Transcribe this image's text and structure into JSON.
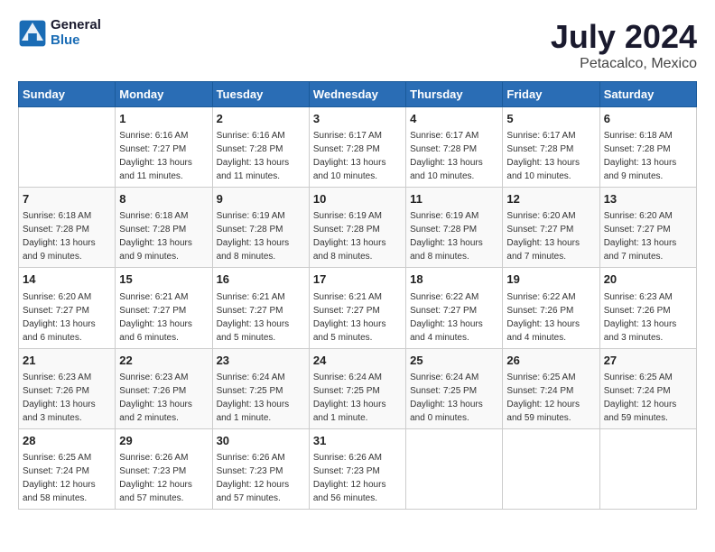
{
  "header": {
    "logo_line1": "General",
    "logo_line2": "Blue",
    "month_year": "July 2024",
    "location": "Petacalco, Mexico"
  },
  "columns": [
    "Sunday",
    "Monday",
    "Tuesday",
    "Wednesday",
    "Thursday",
    "Friday",
    "Saturday"
  ],
  "weeks": [
    [
      {
        "day": "",
        "info": ""
      },
      {
        "day": "1",
        "info": "Sunrise: 6:16 AM\nSunset: 7:27 PM\nDaylight: 13 hours\nand 11 minutes."
      },
      {
        "day": "2",
        "info": "Sunrise: 6:16 AM\nSunset: 7:28 PM\nDaylight: 13 hours\nand 11 minutes."
      },
      {
        "day": "3",
        "info": "Sunrise: 6:17 AM\nSunset: 7:28 PM\nDaylight: 13 hours\nand 10 minutes."
      },
      {
        "day": "4",
        "info": "Sunrise: 6:17 AM\nSunset: 7:28 PM\nDaylight: 13 hours\nand 10 minutes."
      },
      {
        "day": "5",
        "info": "Sunrise: 6:17 AM\nSunset: 7:28 PM\nDaylight: 13 hours\nand 10 minutes."
      },
      {
        "day": "6",
        "info": "Sunrise: 6:18 AM\nSunset: 7:28 PM\nDaylight: 13 hours\nand 9 minutes."
      }
    ],
    [
      {
        "day": "7",
        "info": "Sunrise: 6:18 AM\nSunset: 7:28 PM\nDaylight: 13 hours\nand 9 minutes."
      },
      {
        "day": "8",
        "info": "Sunrise: 6:18 AM\nSunset: 7:28 PM\nDaylight: 13 hours\nand 9 minutes."
      },
      {
        "day": "9",
        "info": "Sunrise: 6:19 AM\nSunset: 7:28 PM\nDaylight: 13 hours\nand 8 minutes."
      },
      {
        "day": "10",
        "info": "Sunrise: 6:19 AM\nSunset: 7:28 PM\nDaylight: 13 hours\nand 8 minutes."
      },
      {
        "day": "11",
        "info": "Sunrise: 6:19 AM\nSunset: 7:28 PM\nDaylight: 13 hours\nand 8 minutes."
      },
      {
        "day": "12",
        "info": "Sunrise: 6:20 AM\nSunset: 7:27 PM\nDaylight: 13 hours\nand 7 minutes."
      },
      {
        "day": "13",
        "info": "Sunrise: 6:20 AM\nSunset: 7:27 PM\nDaylight: 13 hours\nand 7 minutes."
      }
    ],
    [
      {
        "day": "14",
        "info": "Sunrise: 6:20 AM\nSunset: 7:27 PM\nDaylight: 13 hours\nand 6 minutes."
      },
      {
        "day": "15",
        "info": "Sunrise: 6:21 AM\nSunset: 7:27 PM\nDaylight: 13 hours\nand 6 minutes."
      },
      {
        "day": "16",
        "info": "Sunrise: 6:21 AM\nSunset: 7:27 PM\nDaylight: 13 hours\nand 5 minutes."
      },
      {
        "day": "17",
        "info": "Sunrise: 6:21 AM\nSunset: 7:27 PM\nDaylight: 13 hours\nand 5 minutes."
      },
      {
        "day": "18",
        "info": "Sunrise: 6:22 AM\nSunset: 7:27 PM\nDaylight: 13 hours\nand 4 minutes."
      },
      {
        "day": "19",
        "info": "Sunrise: 6:22 AM\nSunset: 7:26 PM\nDaylight: 13 hours\nand 4 minutes."
      },
      {
        "day": "20",
        "info": "Sunrise: 6:23 AM\nSunset: 7:26 PM\nDaylight: 13 hours\nand 3 minutes."
      }
    ],
    [
      {
        "day": "21",
        "info": "Sunrise: 6:23 AM\nSunset: 7:26 PM\nDaylight: 13 hours\nand 3 minutes."
      },
      {
        "day": "22",
        "info": "Sunrise: 6:23 AM\nSunset: 7:26 PM\nDaylight: 13 hours\nand 2 minutes."
      },
      {
        "day": "23",
        "info": "Sunrise: 6:24 AM\nSunset: 7:25 PM\nDaylight: 13 hours\nand 1 minute."
      },
      {
        "day": "24",
        "info": "Sunrise: 6:24 AM\nSunset: 7:25 PM\nDaylight: 13 hours\nand 1 minute."
      },
      {
        "day": "25",
        "info": "Sunrise: 6:24 AM\nSunset: 7:25 PM\nDaylight: 13 hours\nand 0 minutes."
      },
      {
        "day": "26",
        "info": "Sunrise: 6:25 AM\nSunset: 7:24 PM\nDaylight: 12 hours\nand 59 minutes."
      },
      {
        "day": "27",
        "info": "Sunrise: 6:25 AM\nSunset: 7:24 PM\nDaylight: 12 hours\nand 59 minutes."
      }
    ],
    [
      {
        "day": "28",
        "info": "Sunrise: 6:25 AM\nSunset: 7:24 PM\nDaylight: 12 hours\nand 58 minutes."
      },
      {
        "day": "29",
        "info": "Sunrise: 6:26 AM\nSunset: 7:23 PM\nDaylight: 12 hours\nand 57 minutes."
      },
      {
        "day": "30",
        "info": "Sunrise: 6:26 AM\nSunset: 7:23 PM\nDaylight: 12 hours\nand 57 minutes."
      },
      {
        "day": "31",
        "info": "Sunrise: 6:26 AM\nSunset: 7:23 PM\nDaylight: 12 hours\nand 56 minutes."
      },
      {
        "day": "",
        "info": ""
      },
      {
        "day": "",
        "info": ""
      },
      {
        "day": "",
        "info": ""
      }
    ]
  ]
}
